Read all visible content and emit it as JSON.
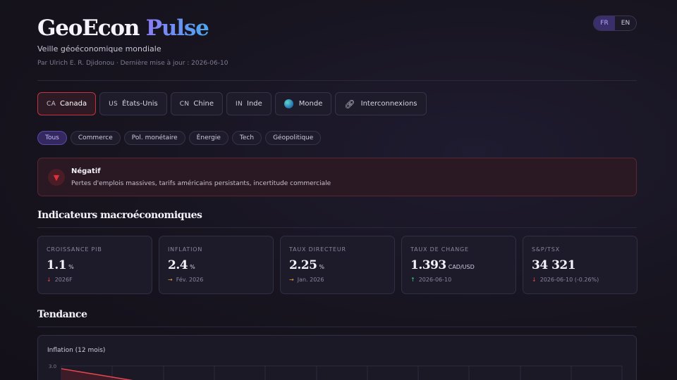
{
  "header": {
    "brand_main": "GeoEcon",
    "brand_accent": "Pulse",
    "tagline": "Veille géoéconomique mondiale",
    "byline": "Par Ulrich E. R. Djidonou · Dernière mise à jour : 2026-06-10",
    "lang": {
      "fr": "FR",
      "en": "EN",
      "active": "FR"
    }
  },
  "tabs": [
    {
      "code": "CA",
      "label": "Canada",
      "active": true
    },
    {
      "code": "US",
      "label": "États-Unis"
    },
    {
      "code": "CN",
      "label": "Chine"
    },
    {
      "code": "IN",
      "label": "Inde"
    },
    {
      "icon": "globe-icon",
      "label": "Monde"
    },
    {
      "icon": "link-icon",
      "label": "Interconnexions"
    }
  ],
  "filters": [
    "Tous",
    "Commerce",
    "Pol. monétaire",
    "Énergie",
    "Tech",
    "Géopolitique"
  ],
  "sentiment": {
    "title": "Négatif",
    "description": "Pertes d'emplois massives, tarifs américains persistants, incertitude commerciale",
    "color": "#e0303a"
  },
  "sections": {
    "macro": "Indicateurs macroéconomiques",
    "trend": "Tendance"
  },
  "kpis": [
    {
      "label": "CROISSANCE PIB",
      "value": "1.1",
      "unit": "%",
      "trend": "down",
      "arrow": "↓",
      "note": "2026F"
    },
    {
      "label": "INFLATION",
      "value": "2.4",
      "unit": "%",
      "trend": "flat",
      "arrow": "→",
      "note": "Fév. 2026"
    },
    {
      "label": "TAUX DIRECTEUR",
      "value": "2.25",
      "unit": "%",
      "trend": "flat",
      "arrow": "→",
      "note": "Jan. 2026"
    },
    {
      "label": "TAUX DE CHANGE",
      "value": "1.393",
      "unit": "CAD/USD",
      "trend": "up",
      "arrow": "↑",
      "note": "2026-06-10"
    },
    {
      "label": "S&P/TSX",
      "value": "34 321",
      "unit": "",
      "trend": "down",
      "arrow": "↓",
      "note": "2026-06-10 (-0.26%)"
    }
  ],
  "chart": {
    "title": "Inflation (12 mois)",
    "ytick_top": "3.0",
    "line_color": "#e0454d"
  }
}
